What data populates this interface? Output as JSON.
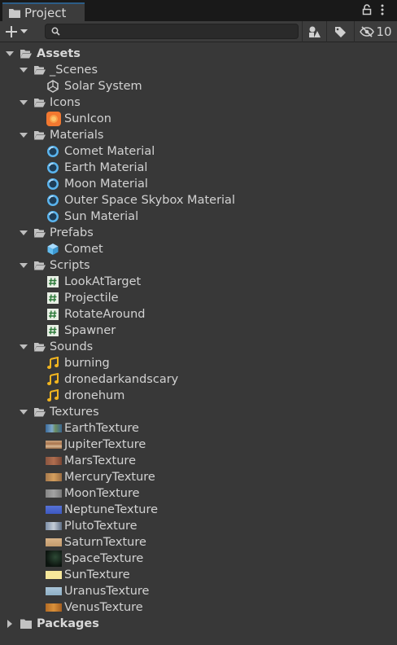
{
  "window": {
    "tab_title": "Project",
    "hidden_count": "10"
  },
  "search": {
    "value": "",
    "placeholder": ""
  },
  "tree": {
    "assets": "Assets",
    "scenes": "_Scenes",
    "solar_system": "Solar System",
    "icons": "Icons",
    "sun_icon": "SunIcon",
    "materials": "Materials",
    "comet_material": "Comet Material",
    "earth_material": "Earth Material",
    "moon_material": "Moon Material",
    "skybox_material": "Outer Space Skybox Material",
    "sun_material": "Sun Material",
    "prefabs": "Prefabs",
    "comet": "Comet",
    "scripts": "Scripts",
    "look_at_target": "LookAtTarget",
    "projectile": "Projectile",
    "rotate_around": "RotateAround",
    "spawner": "Spawner",
    "sounds": "Sounds",
    "burning": "burning",
    "dronedarkandscary": "dronedarkandscary",
    "dronehum": "dronehum",
    "textures": "Textures",
    "earth_texture": "EarthTexture",
    "jupiter_texture": "JupiterTexture",
    "mars_texture": "MarsTexture",
    "mercury_texture": "MercuryTexture",
    "moon_texture": "MoonTexture",
    "neptune_texture": "NeptuneTexture",
    "pluto_texture": "PlutoTexture",
    "saturn_texture": "SaturnTexture",
    "space_texture": "SpaceTexture",
    "sun_texture": "SunTexture",
    "uranus_texture": "UranusTexture",
    "venus_texture": "VenusTexture",
    "packages": "Packages"
  },
  "colors": {
    "background": "#383838",
    "title_bar": "#191919",
    "tab_accent": "#2c5d87",
    "material_icon": "#5ab4ee",
    "prefab_icon": "#62bdf0",
    "script_icon": "#e9f0e6",
    "audio_icon": "#f2b51f",
    "sun_icon": "#f27830"
  },
  "icons": {
    "tab": "folder-icon",
    "lock": "lock-icon",
    "menu": "kebab-menu-icon",
    "create": "plus-icon",
    "search": "search-icon",
    "filter_type": "filter-by-type-icon",
    "filter_label": "filter-by-label-icon",
    "hidden_packages": "eye-slash-icon"
  }
}
